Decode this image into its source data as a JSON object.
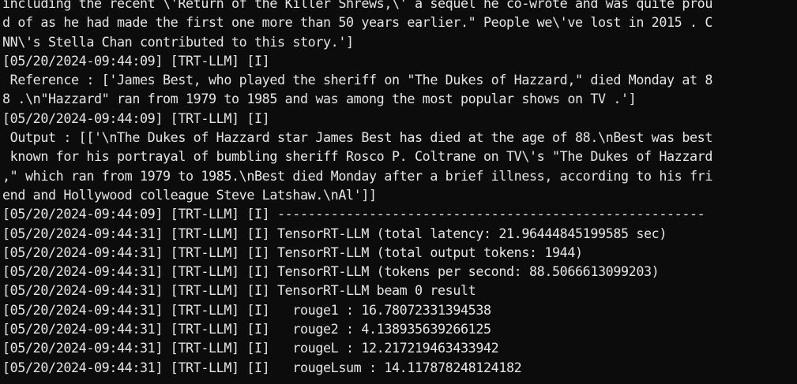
{
  "terminal": {
    "lines": [
      "including the recent \\'Return of the Killer Shrews,\\' a sequel he co-wrote and was quite prou",
      "d of as he had made the first one more than 50 years earlier.\" People we\\'ve lost in 2015 . C",
      "NN\\'s Stella Chan contributed to this story.']",
      "[05/20/2024-09:44:09] [TRT-LLM] [I]",
      " Reference : ['James Best, who played the sheriff on \"The Dukes of Hazzard,\" died Monday at 8",
      "8 .\\n\"Hazzard\" ran from 1979 to 1985 and was among the most popular shows on TV .']",
      "[05/20/2024-09:44:09] [TRT-LLM] [I]",
      " Output : [['\\nThe Dukes of Hazzard star James Best has died at the age of 88.\\nBest was best",
      " known for his portrayal of bumbling sheriff Rosco P. Coltrane on TV\\'s \"The Dukes of Hazzard",
      ",\" which ran from 1979 to 1985.\\nBest died Monday after a brief illness, according to his fri",
      "end and Hollywood colleague Steve Latshaw.\\nAl']]",
      "[05/20/2024-09:44:09] [TRT-LLM] [I] --------------------------------------------------------",
      "[05/20/2024-09:44:31] [TRT-LLM] [I] TensorRT-LLM (total latency: 21.96444845199585 sec)",
      "[05/20/2024-09:44:31] [TRT-LLM] [I] TensorRT-LLM (total output tokens: 1944)",
      "[05/20/2024-09:44:31] [TRT-LLM] [I] TensorRT-LLM (tokens per second: 88.5066613099203)",
      "[05/20/2024-09:44:31] [TRT-LLM] [I] TensorRT-LLM beam 0 result",
      "[05/20/2024-09:44:31] [TRT-LLM] [I]   rouge1 : 16.78072331394538",
      "[05/20/2024-09:44:31] [TRT-LLM] [I]   rouge2 : 4.138935639266125",
      "[05/20/2024-09:44:31] [TRT-LLM] [I]   rougeL : 12.217219463433942",
      "[05/20/2024-09:44:31] [TRT-LLM] [I]   rougeLsum : 14.117878248124182"
    ]
  }
}
